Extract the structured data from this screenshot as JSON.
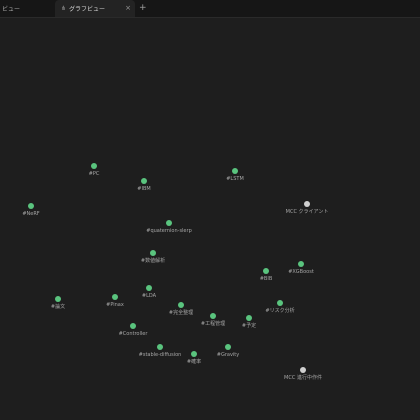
{
  "tabs": [
    {
      "label": "ビュー",
      "active": false
    },
    {
      "label": "グラフビュー",
      "active": true,
      "icon": "graph-icon"
    }
  ],
  "new_tab_label": "+",
  "close_label": "×",
  "colors": {
    "tag_node": "#5ac47e",
    "file_node": "#d0d0d0",
    "background": "#1e1e1e"
  },
  "nodes": [
    {
      "label": "#PC"
    },
    {
      "label": "#IBM"
    },
    {
      "label": "#LSTM"
    },
    {
      "label": "#NeRF"
    },
    {
      "label": "MCC クライアント"
    },
    {
      "label": "#quaternion-slerp"
    },
    {
      "label": "#数値解析"
    },
    {
      "label": "#BIB"
    },
    {
      "label": "#XGBoost"
    },
    {
      "label": "#LDA"
    },
    {
      "label": "#論文"
    },
    {
      "label": "#Pinax"
    },
    {
      "label": "#完全整理"
    },
    {
      "label": "#リスク分析"
    },
    {
      "label": "#工程管理"
    },
    {
      "label": "#予定"
    },
    {
      "label": "#Controller"
    },
    {
      "label": "#stable-diffusion"
    },
    {
      "label": "#Gravity"
    },
    {
      "label": "#確率"
    },
    {
      "label": "MCC 進行中作件"
    }
  ]
}
